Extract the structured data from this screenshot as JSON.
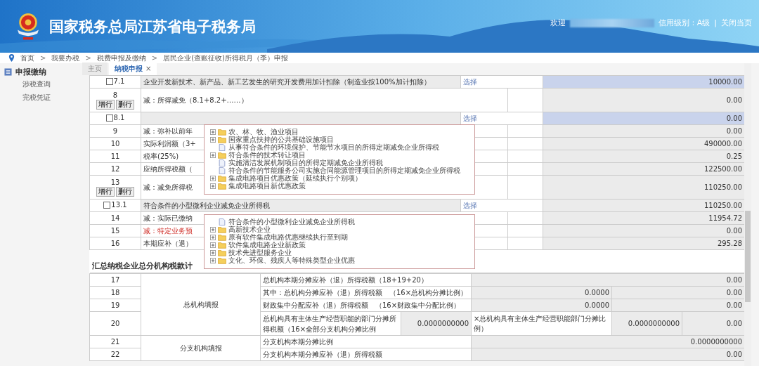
{
  "header": {
    "title": "国家税务总局江苏省电子税务局",
    "welcome": "欢迎",
    "credit": "信用级别：A级",
    "separator": "|",
    "close": "关闭当页"
  },
  "breadcrumb": [
    {
      "label": "首页"
    },
    {
      "label": "我要办税",
      "separator": ">"
    },
    {
      "label": "税费申报及缴纳",
      "separator": ">"
    },
    {
      "label": "居民企业(查账征收)所得税月（季）申报",
      "separator": ">"
    }
  ],
  "sidebar": {
    "section": "申报缴纳",
    "items": [
      {
        "label": "涉税查询"
      },
      {
        "label": "完税凭证"
      }
    ]
  },
  "tabs": [
    {
      "label": "主页",
      "selected": false
    },
    {
      "label": "纳税申报",
      "selected": true,
      "close": "×"
    }
  ],
  "form_rows": [
    {
      "kind": "sub",
      "number": "7.1",
      "checked": false,
      "description": "企业开发新技术、新产品、新工艺发生的研究开发费用加计扣除（制造业按100%加计扣除）",
      "action": "选择",
      "value": "10000.00",
      "active": true
    },
    {
      "kind": "main",
      "number": "8",
      "buttons": [
        "增行",
        "删行"
      ],
      "description": "减：所得减免（8.1+8.2+……）",
      "value": "0.00",
      "alert": false
    },
    {
      "kind": "sub",
      "number": "8.1",
      "checked": false,
      "action": "选择",
      "value": "0.00",
      "active": true
    },
    {
      "kind": "main",
      "number": "9",
      "description": "减：弥补以前年",
      "value": "0.00",
      "alert": false
    },
    {
      "kind": "main",
      "number": "10",
      "description": "实际利润额（3+",
      "value": "490000.00",
      "alert": false
    },
    {
      "kind": "main",
      "number": "11",
      "description": "税率(25%)",
      "value": "0.25",
      "alert": false
    },
    {
      "kind": "main",
      "number": "12",
      "description": "应纳所得税额（",
      "value": "122500.00",
      "alert": false
    },
    {
      "kind": "main",
      "number": "13",
      "buttons": [
        "增行",
        "删行"
      ],
      "description": "减：减免所得税",
      "value": "110250.00",
      "alert": false
    },
    {
      "kind": "sub",
      "number": "13.1",
      "checked": false,
      "description": "符合条件的小型微利企业减免企业所得税",
      "action": "选择",
      "value": "110250.00",
      "active": false
    },
    {
      "kind": "main",
      "number": "14",
      "description": "减：实际已缴纳",
      "value": "11954.72",
      "alert": false
    },
    {
      "kind": "main",
      "number": "15",
      "description": "减：特定业务预",
      "value": "0.00",
      "alert": true
    },
    {
      "kind": "main",
      "number": "16",
      "description": "本期应补（退）",
      "value": "295.28",
      "alert": false
    }
  ],
  "section_title": "汇总纳税企业总分机构税款计",
  "summary_groups": [
    {
      "label": "总机构填报",
      "rows": [
        {
          "kind": "single",
          "number": "17",
          "description": "总机构本期分摊应补（退）所得税额（18+19+20）",
          "value": "0.00"
        },
        {
          "kind": "ratio",
          "number": "18",
          "description": "其中：总机构分摊应补（退）所得税额　（16×总机构分摊比例）",
          "ratio": "0.0000",
          "value": "0.00"
        },
        {
          "kind": "ratio",
          "number": "19",
          "description": "财政集中分配应补（退）所得税额　（16×财政集中分配比例）",
          "ratio": "0.0000",
          "value": "0.00"
        },
        {
          "kind": "split",
          "number": "20",
          "description": "总机构具有主体生产经营职能的部门分摊所得税额（16×全部分支机构分摊比例",
          "ratio": "0.0000000000",
          "note": "×总机构具有主体生产经营职能部门分摊比例）",
          "ratio_2": "0.0000000000",
          "value": "0.00"
        }
      ]
    },
    {
      "label": "分支机构填报",
      "rows": [
        {
          "kind": "single",
          "number": "21",
          "description": "分支机构本期分摊比例",
          "value": "0.0000000000"
        },
        {
          "kind": "single",
          "number": "22",
          "description": "分支机构本期分摊应补（退）所得税额",
          "value": "0.00"
        }
      ]
    }
  ],
  "popups": [
    {
      "items": [
        {
          "kind": "folder",
          "label": "农、林、牧、渔业项目"
        },
        {
          "kind": "folder",
          "label": "国家重点扶持的公共基础设施项目"
        },
        {
          "kind": "file",
          "label": "从事符合条件的环境保护、节能节水项目的所得定期减免企业所得税"
        },
        {
          "kind": "folder",
          "label": "符合条件的技术转让项目"
        },
        {
          "kind": "file",
          "label": "实施清洁发展机制项目的所得定期减免企业所得税"
        },
        {
          "kind": "file",
          "label": "符合条件的节能服务公司实施合同能源管理项目的所得定期减免企业所得税"
        },
        {
          "kind": "folder",
          "label": "集成电路项目优惠政策（延续执行个别项）"
        },
        {
          "kind": "folder",
          "label": "集成电路项目新优惠政策"
        }
      ]
    },
    {
      "items": [
        {
          "kind": "file",
          "label": "符合条件的小型微利企业减免企业所得税"
        },
        {
          "kind": "folder",
          "label": "高新技术企业"
        },
        {
          "kind": "folder",
          "label": "原有软件集成电路优惠继续执行至到期"
        },
        {
          "kind": "folder",
          "label": "软件集成电路企业新政策"
        },
        {
          "kind": "folder",
          "label": "技术先进型服务企业"
        },
        {
          "kind": "folder",
          "label": "文化、环保、残疾人等特殊类型企业优惠"
        }
      ]
    }
  ]
}
